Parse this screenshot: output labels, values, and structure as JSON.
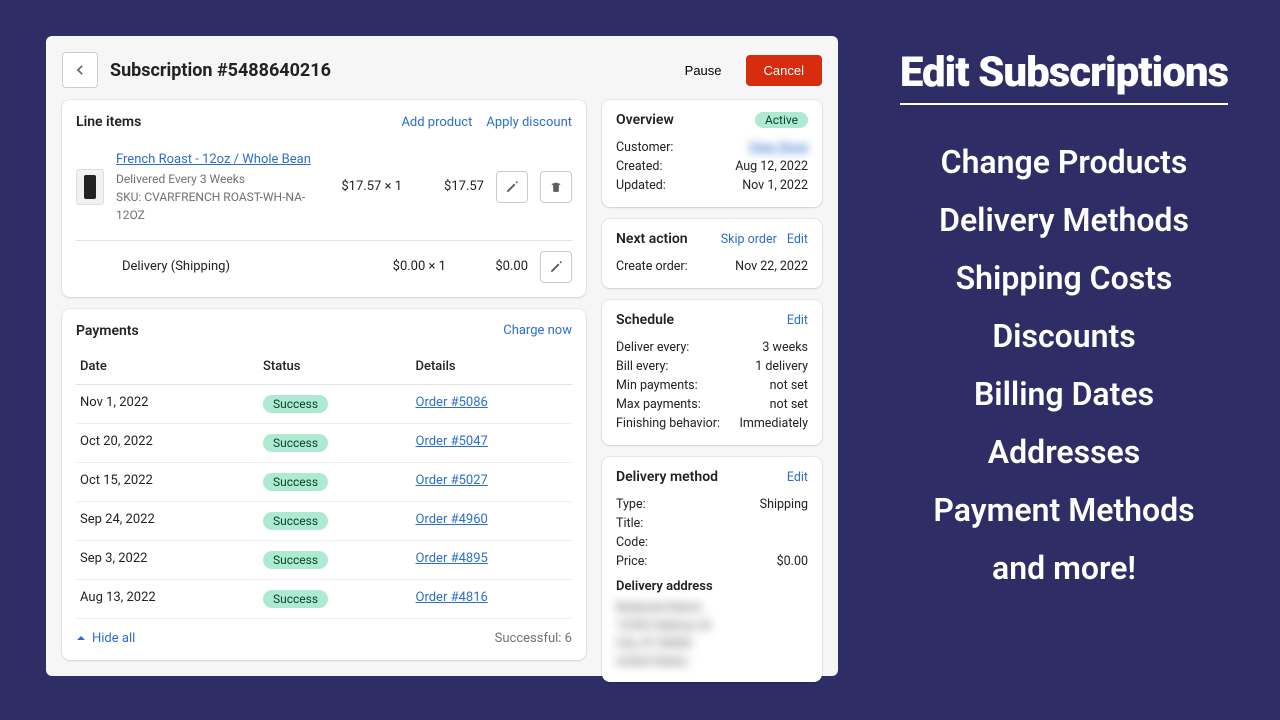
{
  "header": {
    "title": "Subscription #5488640216",
    "pause": "Pause",
    "cancel": "Cancel"
  },
  "lineItems": {
    "title": "Line items",
    "addProduct": "Add product",
    "applyDiscount": "Apply discount",
    "item": {
      "name": "French Roast - 12oz / Whole Bean",
      "delivered": "Delivered Every 3 Weeks",
      "sku": "SKU: CVARFRENCH ROAST-WH-NA-12OZ",
      "priceQty": "$17.57 × 1",
      "total": "$17.57"
    },
    "delivery": {
      "label": "Delivery (Shipping)",
      "priceQty": "$0.00 × 1",
      "total": "$0.00"
    }
  },
  "payments": {
    "title": "Payments",
    "chargeNow": "Charge now",
    "cols": {
      "date": "Date",
      "status": "Status",
      "details": "Details"
    },
    "rows": [
      {
        "date": "Nov 1, 2022",
        "status": "Success",
        "order": "Order #5086"
      },
      {
        "date": "Oct 20, 2022",
        "status": "Success",
        "order": "Order #5047"
      },
      {
        "date": "Oct 15, 2022",
        "status": "Success",
        "order": "Order #5027"
      },
      {
        "date": "Sep 24, 2022",
        "status": "Success",
        "order": "Order #4960"
      },
      {
        "date": "Sep 3, 2022",
        "status": "Success",
        "order": "Order #4895"
      },
      {
        "date": "Aug 13, 2022",
        "status": "Success",
        "order": "Order #4816"
      }
    ],
    "hideAll": "Hide all",
    "successful": "Successful: 6"
  },
  "overview": {
    "title": "Overview",
    "status": "Active",
    "customerLabel": "Customer:",
    "customerValue": "View Store",
    "createdLabel": "Created:",
    "createdValue": "Aug 12, 2022",
    "updatedLabel": "Updated:",
    "updatedValue": "Nov 1, 2022"
  },
  "nextAction": {
    "title": "Next action",
    "skip": "Skip order",
    "edit": "Edit",
    "createLabel": "Create order:",
    "createValue": "Nov 22, 2022"
  },
  "schedule": {
    "title": "Schedule",
    "edit": "Edit",
    "deliverEveryL": "Deliver every:",
    "deliverEveryV": "3 weeks",
    "billEveryL": "Bill every:",
    "billEveryV": "1 delivery",
    "minPayL": "Min payments:",
    "minPayV": "not set",
    "maxPayL": "Max payments:",
    "maxPayV": "not set",
    "finishL": "Finishing behavior:",
    "finishV": "Immediately"
  },
  "deliveryMethod": {
    "title": "Delivery method",
    "edit": "Edit",
    "typeL": "Type:",
    "typeV": "Shipping",
    "titleL": "Title:",
    "titleV": "",
    "codeL": "Code:",
    "codeV": "",
    "priceL": "Price:",
    "priceV": "$0.00",
    "addressTitle": "Delivery address",
    "addressBlock": "Redacted Name\n12345 Address St\nCity, ST 00000\nUnited States"
  },
  "promo": {
    "heading": "Edit Subscriptions",
    "lines": [
      "Change Products",
      "Delivery Methods",
      "Shipping Costs",
      "Discounts",
      "Billing Dates",
      "Addresses",
      "Payment Methods",
      "and more!"
    ]
  }
}
